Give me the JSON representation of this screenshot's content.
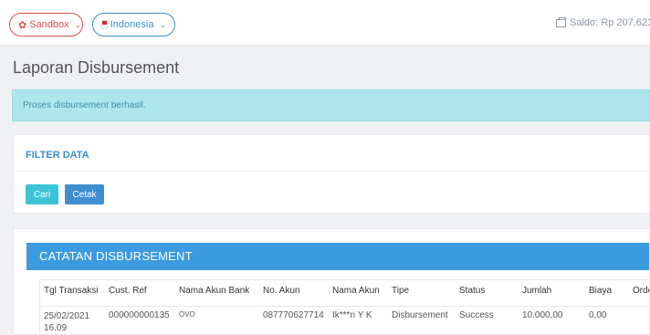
{
  "topbar": {
    "env_label": "Sandbox",
    "country_label": "Indonesia",
    "saldo_label": "Saldo: Rp 207.621.8"
  },
  "page": {
    "title": "Laporan Disbursement"
  },
  "alert": {
    "message": "Proses disbursement berhasil."
  },
  "filter": {
    "title": "FILTER DATA",
    "search_button": "Cari",
    "print_button": "Cetak"
  },
  "records": {
    "title": "CATATAN DISBURSEMENT",
    "columns": [
      "Tgl Transaksi",
      "Cust. Ref",
      "Nama Akun Bank",
      "No. Akun",
      "Nama Akun",
      "Tipe",
      "Status",
      "Jumlah",
      "Biaya",
      "Orde"
    ],
    "rows": [
      {
        "date": "25/02/2021 16.09",
        "cust_ref": "000000000135",
        "bank_name": "OVO",
        "account_no": "087770627714",
        "account_name": "Ik***n Y K",
        "type": "Disbursement",
        "status": "Success",
        "amount": "10.000,00",
        "fee": "0,00",
        "order": ""
      }
    ]
  },
  "colors": {
    "sandbox": "#d9534f",
    "country": "#3a8fc8",
    "alert_bg": "#aee6ee",
    "header_bar": "#3a9be0",
    "btn_cari": "#3ac4d6",
    "btn_cetak": "#3e8fd1"
  },
  "icons": {
    "env": "gear-icon",
    "country": "indonesia-flag-icon",
    "dropdown": "chevron-down-icon",
    "saldo": "wallet-icon"
  }
}
